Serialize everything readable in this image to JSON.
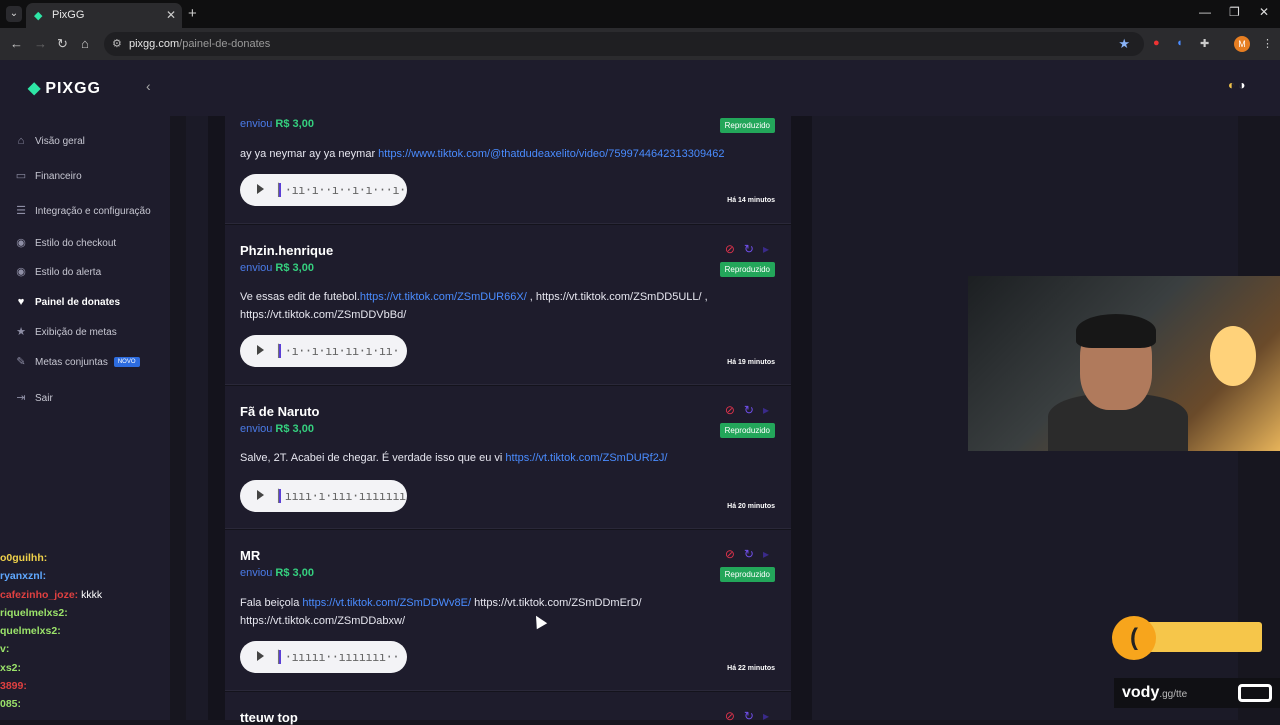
{
  "browser": {
    "tab_title": "PixGG",
    "url_host": "pixgg.com",
    "url_path": "/painel-de-donates",
    "profile_initial": "M"
  },
  "app": {
    "logo": "PIXGG",
    "nav": [
      {
        "label": "Visão geral",
        "icon": "home-icon"
      },
      {
        "label": "Financeiro",
        "icon": "wallet-icon"
      },
      {
        "label": "Integração e configuração",
        "icon": "settings-icon"
      },
      {
        "label": "Estilo do checkout",
        "icon": "palette-icon"
      },
      {
        "label": "Estilo do alerta",
        "icon": "palette-icon"
      },
      {
        "label": "Painel de donates",
        "icon": "donate-icon"
      },
      {
        "label": "Exibição de metas",
        "icon": "star-icon"
      },
      {
        "label": "Metas conjuntas",
        "icon": "goals-icon",
        "badge": "NOVO"
      },
      {
        "label": "Sair",
        "icon": "logout-icon"
      }
    ],
    "active_nav": "Painel de donates",
    "colors": {
      "accent": "#2ee6a6",
      "sent": "#4a7be8",
      "amount": "#35d07f",
      "status": "#23a65a",
      "ban": "#e2334c",
      "replay": "#6f4ee8"
    }
  },
  "donations": [
    {
      "name": "",
      "sent_label": "enviou",
      "amount": "R$ 3,00",
      "message_text": "ay ya neymar ay ya neymar ",
      "message_link": "https://www.tiktok.com/@thatdudeaxelito/video/7599744642313309462",
      "message_rest": "",
      "status": "Reproduzido",
      "time": "Há 14 minutos"
    },
    {
      "name": "Phzin.henrique",
      "sent_label": "enviou",
      "amount": "R$ 3,00",
      "message_text": "Ve essas edit de futebol.",
      "message_link": "https://vt.tiktok.com/ZSmDUR66X/",
      "message_rest": " , https://vt.tiktok.com/ZSmDD5ULL/ , https://vt.tiktok.com/ZSmDDVbBd/",
      "status": "Reproduzido",
      "time": "Há 19 minutos"
    },
    {
      "name": "Fã de Naruto",
      "sent_label": "enviou",
      "amount": "R$ 3,00",
      "message_text": "Salve, 2T. Acabei de chegar. É verdade isso que eu vi ",
      "message_link": "https://vt.tiktok.com/ZSmDURf2J/",
      "message_rest": "",
      "status": "Reproduzido",
      "time": "Há 20 minutos"
    },
    {
      "name": "MR",
      "sent_label": "enviou",
      "amount": "R$ 3,00",
      "message_text": "Fala beiçola ",
      "message_link": "https://vt.tiktok.com/ZSmDDWv8E/",
      "message_rest": " https://vt.tiktok.com/ZSmDDmErD/ https://vt.tiktok.com/ZSmDDabxw/",
      "status": "Reproduzido",
      "time": "Há 22 minutos"
    },
    {
      "name": "tteuw top",
      "sent_label": "",
      "amount": "",
      "message_text": "",
      "message_link": "",
      "message_rest": "",
      "status": "",
      "time": ""
    }
  ],
  "overlay": {
    "chat": [
      {
        "user": "o0guilhh:",
        "text": "",
        "color": "#f0d24b"
      },
      {
        "user": "ryanxznl:",
        "text": "",
        "color": "#5fa8ff"
      },
      {
        "user": "cafezinho_joze:",
        "text": " kkkk",
        "color": "#e04040"
      },
      {
        "user": "riquelmelxs2:",
        "text": "",
        "color": "#9be36a"
      },
      {
        "user": "quelmelxs2:",
        "text": "",
        "color": "#9be36a"
      },
      {
        "user": "v:",
        "text": "",
        "color": "#9be36a"
      },
      {
        "user": "xs2:",
        "text": "",
        "color": "#9be36a"
      },
      {
        "user": "3899:",
        "text": "",
        "color": "#e04040"
      },
      {
        "user": "085:",
        "text": "",
        "color": "#9be36a"
      }
    ],
    "brand": "vody",
    "brand_suffix": ".gg/tte"
  }
}
